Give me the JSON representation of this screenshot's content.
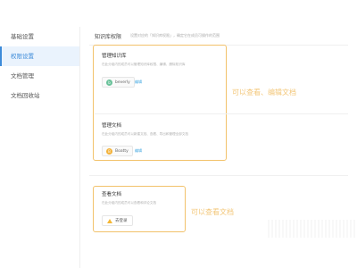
{
  "sidebar": {
    "items": [
      {
        "label": "基础设置",
        "active": false
      },
      {
        "label": "权限设置",
        "active": true
      },
      {
        "label": "文档管理",
        "active": false
      },
      {
        "label": "文档回收站",
        "active": false
      }
    ]
  },
  "header": {
    "title": "知识库权限",
    "description": "设置对应的「知识库权限」，确定它在成员可操作的范围"
  },
  "panels": {
    "manage_kb": {
      "title": "管理知识库",
      "desc": "在此分组内的成员可以管理知识库权限、编辑、删除知识库",
      "member": {
        "name": "beverly",
        "avatar_letter": "b",
        "avatar_color": "#6ac29a"
      },
      "edit_label": "编辑"
    },
    "manage_docs": {
      "title": "管理文档",
      "desc": "在此分组内的成员可以新建文档、查看、导出和管理全部文档",
      "member": {
        "name": "Boatty",
        "avatar_letter": "B",
        "avatar_color": "#f3b23a"
      },
      "edit_label": "编辑"
    },
    "view_docs": {
      "title": "查看文档",
      "desc": "在此分组内的成员可以查看和评论文档",
      "login_label": "去登录"
    }
  },
  "annotations": {
    "edit_hint": "可以查看、编辑文档",
    "view_hint": "可以查看文档"
  },
  "colors": {
    "accent": "#3d8bd9",
    "highlight_border": "#f2c26b",
    "annotation_text": "#f3c77a",
    "link": "#3da5e0"
  }
}
